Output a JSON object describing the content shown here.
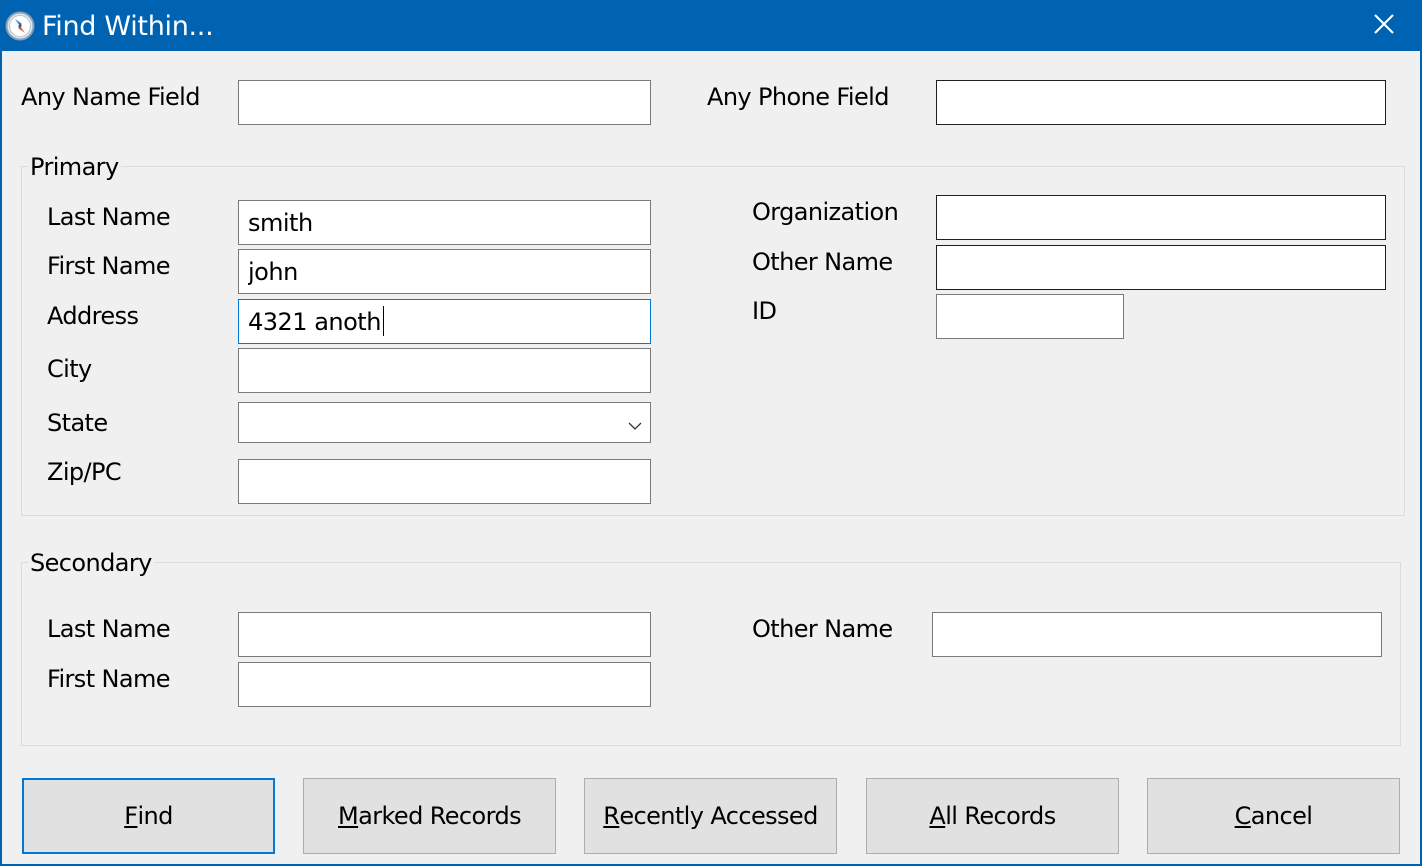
{
  "window": {
    "title": "Find Within...",
    "app_icon": "compass-icon",
    "close_icon": "close-icon"
  },
  "top_fields": {
    "any_name": {
      "label": "Any Name Field",
      "value": ""
    },
    "any_phone": {
      "label": "Any Phone Field",
      "value": ""
    }
  },
  "primary": {
    "title": "Primary",
    "last_name": {
      "label": "Last Name",
      "value": "smith"
    },
    "first_name": {
      "label": "First Name",
      "value": "john"
    },
    "address": {
      "label": "Address",
      "value": "4321 anoth",
      "focused": true
    },
    "city": {
      "label": "City",
      "value": ""
    },
    "state": {
      "label": "State",
      "value": "",
      "icon": "chevron-down-icon"
    },
    "zip": {
      "label": "Zip/PC",
      "value": ""
    },
    "organization": {
      "label": "Organization",
      "value": ""
    },
    "other_name": {
      "label": "Other Name",
      "value": ""
    },
    "id": {
      "label": "ID",
      "value": ""
    }
  },
  "secondary": {
    "title": "Secondary",
    "last_name": {
      "label": "Last Name",
      "value": ""
    },
    "first_name": {
      "label": "First Name",
      "value": ""
    },
    "other_name": {
      "label": "Other Name",
      "value": ""
    }
  },
  "buttons": {
    "find": {
      "mnemonic": "F",
      "rest": "ind",
      "default": true
    },
    "marked": {
      "mnemonic": "M",
      "rest": "arked Records"
    },
    "recent": {
      "mnemonic": "R",
      "rest": "ecently Accessed"
    },
    "all": {
      "mnemonic": "A",
      "rest": "ll Records"
    },
    "cancel": {
      "mnemonic": "C",
      "rest": "ancel"
    }
  },
  "colors": {
    "titlebar": "#0063b1",
    "focus_border": "#0078d7",
    "dialog_bg": "#f0f0f0",
    "button_bg": "#e1e1e1"
  }
}
